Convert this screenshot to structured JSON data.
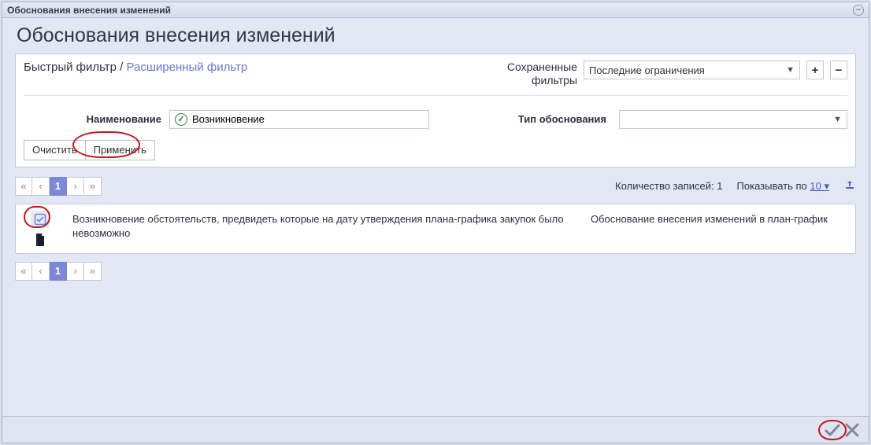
{
  "window": {
    "title": "Обоснования внесения изменений"
  },
  "page": {
    "title": "Обоснования внесения изменений"
  },
  "filter": {
    "quick_label": "Быстрый фильтр",
    "sep": " / ",
    "extended_label": "Расширенный фильтр",
    "saved_label1": "Сохраненные",
    "saved_label2": "фильтры",
    "saved_select": "Последние ограничения",
    "plus": "+",
    "minus": "−",
    "field_name_label": "Наименование",
    "field_name_value": "Возникновение",
    "field_type_label": "Тип обоснования",
    "btn_clear": "Очистить",
    "btn_apply": "Применить"
  },
  "pager": {
    "first": "«",
    "prev": "‹",
    "page": "1",
    "next": "›",
    "last": "»"
  },
  "meta": {
    "count_label": "Количество записей: ",
    "count_value": "1",
    "per_page_label": "Показывать по ",
    "per_page_value": "10 ▾"
  },
  "grid": {
    "row1_name": "Возникновение обстоятельств, предвидеть которые на дату утверждения плана-графика закупок было невозможно",
    "row1_type": "Обоснование внесения изменений в план-график"
  }
}
